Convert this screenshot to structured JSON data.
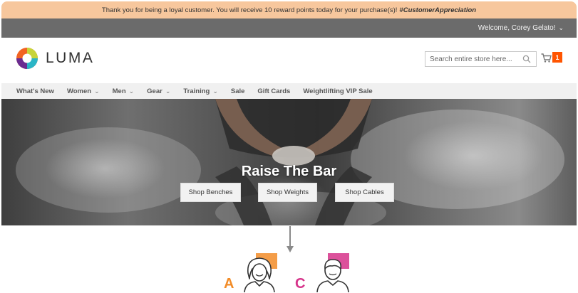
{
  "promo": {
    "message": "Thank you for being a loyal customer. You will receive 10 reward points today for your purchase(s)!",
    "hashtag": "#CustomerAppreciation"
  },
  "account": {
    "welcome": "Welcome, Corey Gelato!"
  },
  "brand": {
    "name": "LUMA",
    "colors": [
      "#f26322",
      "#2ab5c6",
      "#c7d43a",
      "#6a2c91"
    ]
  },
  "search": {
    "placeholder": "Search entire store here...",
    "icon": "search-icon"
  },
  "cart": {
    "count": "1",
    "icon": "cart-icon",
    "badge_color": "#ff5501"
  },
  "nav": {
    "items": [
      {
        "label": "What's New",
        "dropdown": false
      },
      {
        "label": "Women",
        "dropdown": true
      },
      {
        "label": "Men",
        "dropdown": true
      },
      {
        "label": "Gear",
        "dropdown": true
      },
      {
        "label": "Training",
        "dropdown": true
      },
      {
        "label": "Sale",
        "dropdown": false
      },
      {
        "label": "Gift Cards",
        "dropdown": false
      },
      {
        "label": "Weightlifting VIP Sale",
        "dropdown": false
      }
    ]
  },
  "hero": {
    "title": "Raise The Bar",
    "buttons": [
      "Shop Benches",
      "Shop Weights",
      "Shop Cables"
    ]
  },
  "personas": [
    {
      "letter": "A",
      "color": "#f28c28",
      "icon": "woman-avatar-icon"
    },
    {
      "letter": "C",
      "color": "#d6338a",
      "icon": "man-avatar-icon"
    }
  ]
}
